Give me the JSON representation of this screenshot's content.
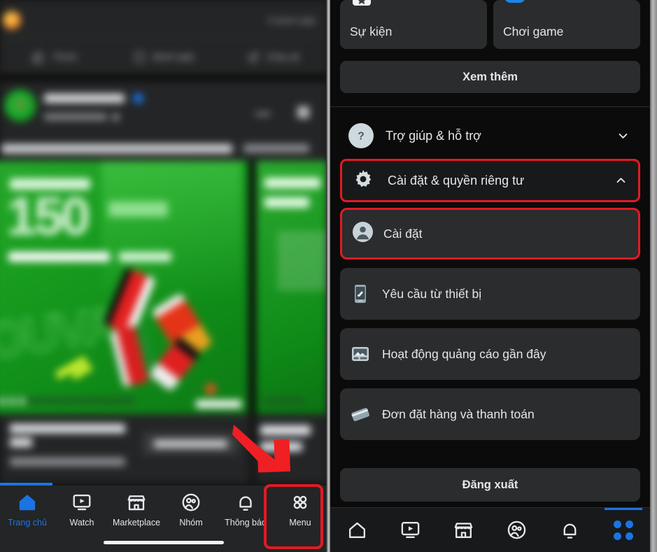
{
  "left_feed": {
    "actions": [
      {
        "label": "Thích",
        "icon": "like-icon"
      },
      {
        "label": "Bình luận",
        "icon": "comment-icon"
      },
      {
        "label": "Chia sẻ",
        "icon": "share-icon"
      }
    ],
    "comment_count": "5 bình luận",
    "ad_number": "150",
    "bottom_nav": [
      {
        "label": "Trang chủ",
        "icon": "home-icon",
        "active": true
      },
      {
        "label": "Watch",
        "icon": "watch-icon",
        "active": false
      },
      {
        "label": "Marketplace",
        "icon": "marketplace-icon",
        "active": false
      },
      {
        "label": "Nhóm",
        "icon": "groups-icon",
        "active": false
      },
      {
        "label": "Thông báo",
        "icon": "bell-icon",
        "active": false
      },
      {
        "label": "Menu",
        "icon": "menu-grid-icon",
        "active": false
      }
    ]
  },
  "right_menu": {
    "tiles": [
      {
        "label": "Sự kiện",
        "icon": "calendar-star-icon"
      },
      {
        "label": "Chơi game",
        "icon": "gamepad-icon"
      }
    ],
    "see_more": "Xem thêm",
    "rows": [
      {
        "label": "Trợ giúp & hỗ trợ",
        "icon": "question-circle-icon",
        "chevron": "chevron-down-icon",
        "highlighted": false
      },
      {
        "label": "Cài đặt & quyền riêng tư",
        "icon": "gear-icon",
        "chevron": "chevron-up-icon",
        "highlighted": true
      }
    ],
    "sub_item": {
      "label": "Cài đặt",
      "icon": "person-circle-icon",
      "highlighted": true
    },
    "menu_items": [
      {
        "label": "Yêu cầu từ thiết bị",
        "icon": "device-request-icon"
      },
      {
        "label": "Hoạt động quảng cáo gần đây",
        "icon": "recent-ad-activity-icon"
      },
      {
        "label": "Đơn đặt hàng và thanh toán",
        "icon": "payment-card-icon"
      }
    ],
    "logout": "Đăng xuất",
    "bottom_nav": [
      {
        "icon": "home-icon",
        "active": false
      },
      {
        "icon": "watch-icon",
        "active": false
      },
      {
        "icon": "marketplace-icon",
        "active": false
      },
      {
        "icon": "groups-icon",
        "active": false
      },
      {
        "icon": "bell-icon",
        "active": false
      },
      {
        "icon": "menu-grid-icon",
        "active": true
      }
    ]
  },
  "annotations": {
    "arrow": "red-arrow-pointing-to-menu",
    "accent_red": "#e01b24",
    "accent_blue": "#1b74e4"
  }
}
